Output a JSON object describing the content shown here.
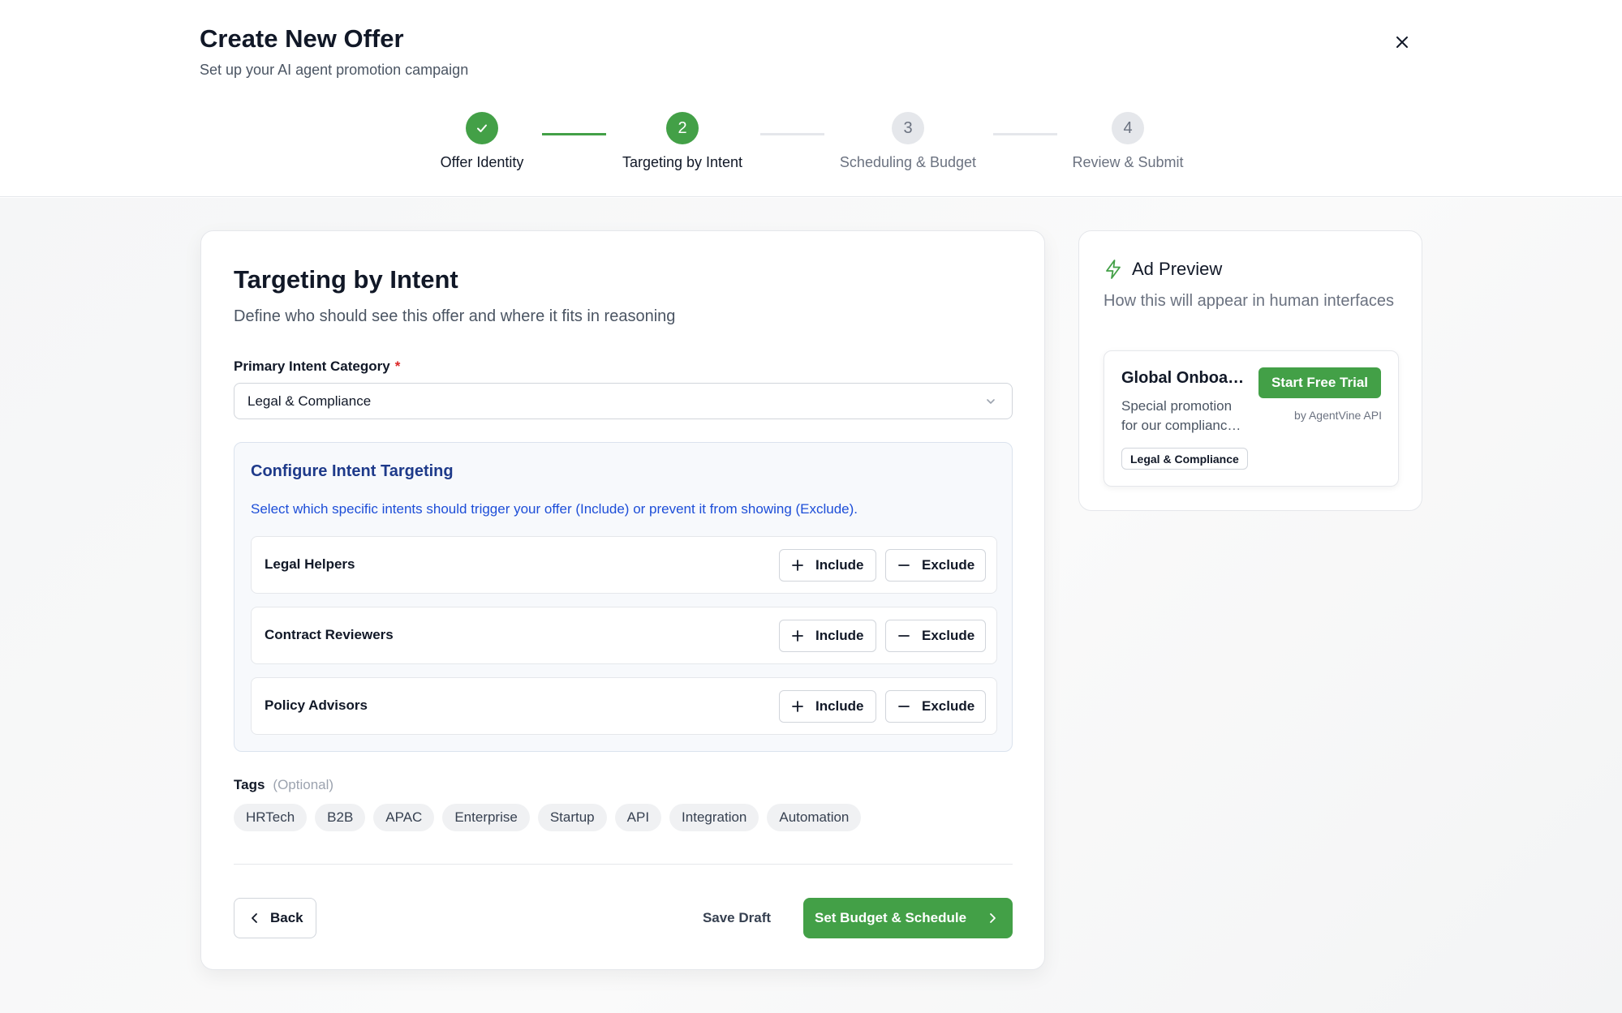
{
  "header": {
    "title": "Create New Offer",
    "subtitle": "Set up your AI agent promotion campaign",
    "close_icon": "close-icon"
  },
  "stepper": {
    "steps": [
      {
        "number": "1",
        "label": "Offer Identity",
        "status": "complete"
      },
      {
        "number": "2",
        "label": "Targeting by Intent",
        "status": "active"
      },
      {
        "number": "3",
        "label": "Scheduling & Budget",
        "status": "upcoming"
      },
      {
        "number": "4",
        "label": "Review & Submit",
        "status": "upcoming"
      }
    ]
  },
  "form": {
    "title": "Targeting by Intent",
    "subtitle": "Define who should see this offer and where it fits in reasoning",
    "primary_intent": {
      "label": "Primary Intent Category",
      "required_mark": "*",
      "value": "Legal & Compliance"
    },
    "config": {
      "title": "Configure Intent Targeting",
      "description": "Select which specific intents should trigger your offer (Include) or prevent it from showing (Exclude).",
      "intents": [
        {
          "name": "Legal Helpers",
          "include": "Include",
          "exclude": "Exclude"
        },
        {
          "name": "Contract Reviewers",
          "include": "Include",
          "exclude": "Exclude"
        },
        {
          "name": "Policy Advisors",
          "include": "Include",
          "exclude": "Exclude"
        }
      ]
    },
    "tags": {
      "label": "Tags",
      "optional": "(Optional)",
      "items": [
        "HRTech",
        "B2B",
        "APAC",
        "Enterprise",
        "Startup",
        "API",
        "Integration",
        "Automation"
      ]
    },
    "actions": {
      "back": "Back",
      "save_draft": "Save Draft",
      "next": "Set Budget & Schedule"
    }
  },
  "preview": {
    "title": "Ad Preview",
    "subtitle": "How this will appear in human interfaces",
    "ad": {
      "title": "Global Onboarding Solutions",
      "description": "Special promotion for our compliance partners",
      "cta": "Start Free Trial",
      "byline": "by AgentVine API",
      "badge": "Legal & Compliance"
    }
  },
  "colors": {
    "accent": "#43a047",
    "config_title": "#1e3a8a",
    "config_text": "#1d4ed8",
    "required": "#dc2626"
  }
}
